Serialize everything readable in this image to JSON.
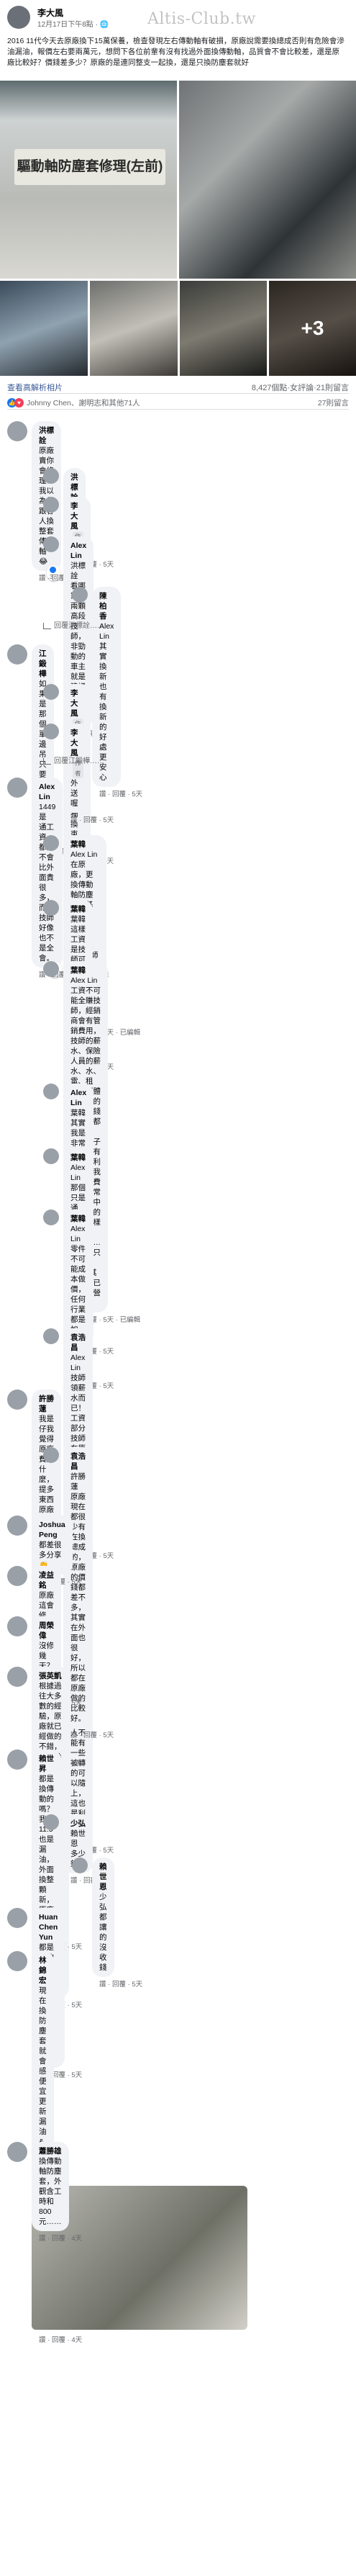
{
  "watermark": "Altis-Club.tw",
  "post": {
    "author": "李大風",
    "time": "12月17日下午8點 · ",
    "text": "2016 11代今天去原廠換下15萬保養，檢查發現左右傳動軸有破損，原廠說需要換總成否則有危險會滲油漏油，報價左右要兩萬元，想問下各位前輩有沒有找過外面換傳動軸，品質會不會比較差，還是原廠比較好？價錢差多少？原廠的是連同整支一起換，還是只換防塵套就好",
    "sign_text": "驅動軸防塵套修理(左前)",
    "more_photos": "+3"
  },
  "bar1": {
    "left": "查看高解析相片",
    "right": "8,427個點·女評論·21則留言"
  },
  "bar2": {
    "reactions": "Johnny Chen、謝明志和其他71人",
    "comments": "27則留言"
  },
  "comments": [
    {
      "name": "洪標詮",
      "text": "原廠賣你會修理？我以為都跟客人換整套傳動軸😂",
      "acts": "讚 · 回覆 · 5天",
      "reacts": "3"
    },
    {
      "name": "洪標詮",
      "text": "修理也價格",
      "acts": "讚 · 回覆 · 5天"
    },
    {
      "name": "李大風",
      "author": "作者",
      "text": "洪標詮 修理後的價格",
      "tag": "洪標詮",
      "acts": "讚 · 回覆 · 5天"
    },
    {
      "name": "Alex Lin",
      "text": "洪標詮 看哪家的兩顆高段技師，非勁動的車主就是建議換新續送。",
      "tag": "洪標詮",
      "acts": "讚 · 回覆 · 5天"
    },
    {
      "name": "陳柏香",
      "text": "Alex Lin 其實換新也有換新的好處 更安心",
      "tag": "Alex Lin",
      "acts": "讚 · 回覆 · 5天"
    },
    {
      "reply_to": "回覆洪標詮……"
    },
    {
      "name": "江鍛樺",
      "text": "如果是那個單邊吊只要要換束環就好",
      "acts": "讚 · 回覆 · 5天"
    },
    {
      "name": "李大風",
      "author": "作者",
      "text": "江明樺 原廠沒單獨換束環",
      "tag": "江明樺",
      "acts": "讚 · 回覆 · 5天"
    },
    {
      "name": "李大風",
      "author": "作者",
      "text": "外送喔",
      "acts": "讚 · 回覆 · 5天"
    },
    {
      "reply_to": "回覆江鍛樺……"
    },
    {
      "name": "Alex Lin",
      "text": "1449是 通工資，都是不會比外面貴很多，而且技師好像也不是全會。",
      "acts": "讚 · 回覆 · 5天 · 已編輯",
      "reacts": "4"
    },
    {
      "name": "葉韓",
      "author": "",
      "text": "Alex Lin 在原廠，更換傳動軸防塵套是基本功，我當年都是在彰化乾(美援)師傅換一個套子$1000，按道理子是真的不貴",
      "tag": "Alex Lin",
      "acts": "讚 · 回覆 · 5天 · 已編輯"
    },
    {
      "name": "葉韓",
      "text": "葉韓 這樣工資是技師可以全拿嗎？還是也要被經銷公司抽成？",
      "tag": "葉韓",
      "acts": "讚 · 回覆 · 5天"
    },
    {
      "name": "葉韓",
      "text": "Alex Lin 工資不可能全賺技師，經銷商會有管銷費用，技師的薪水、保險人員的薪水、水、電、租金、硬體等費用的一切水錢都們，都要花錢買，環子還要卻有上些的利潤。但我一樣收費做是非常的就是中等，你的就與一樣「常觀的。……所以你只「要算」，其實是早已算有運營的表。",
      "tag": "Alex Lin",
      "acts": "讚 · 回覆 · 5天 · 已編輯"
    },
    {
      "name": "Alex Lin",
      "text": "葉韓 其實我是非常贊成不要換的，我也會些做 有什麼。 就和工資他或然比較便宜，就是技術費囉。",
      "tag": "葉韓",
      "acts": "讚 · 回覆 · 5天"
    },
    {
      "name": "葉韓",
      "text": "Alex Lin 那個只是通理，現在要 跟換人收多少，就所以多少利潤，在我這裡是我決定的。",
      "tag": "Alex Lin",
      "acts": "讚 · 回覆 · 5天"
    },
    {
      "name": "葉韓",
      "text": "Alex Lin 零件不可能成本做價，任何行業都是如此，沒利潤誰不才很困擾什麼一樣東西事，工資更不可能全體技師，老闆提供場地、工具設備，這些都是讓維修人員成本的，這些成本要同時將這成本上應計入，有的人不能有一些被轉的可以隨上，這也是利潤的。",
      "tag": "Alex Lin",
      "acts": "讚 · 回覆 · 5天"
    },
    {
      "name": "袁浩昌",
      "text": "Alex Lin 技師領薪水而已！工資部分技師在原廠都是領月薪，被扣工資，一直砍！",
      "tag": "Alex Lin",
      "acts": "讚 · 回覆 · 5天",
      "reacts": "1"
    },
    {
      "name": "許勝蓮",
      "text": "我是仔我覺得原廠費是什麼，提多東西原廠也不會比較貴，都不能完成的話，非常便宜就會換套防塵就好，外面真的比較便宜，你價值比我是換原廠原廠都是換總成。",
      "acts": "讚 · 回覆 · 5天"
    },
    {
      "name": "袁浩昌",
      "text": "許勝蓮 原廠現在都很少有在換總成的，原廠的價錢都差不多，其實在外面也很好，所以都在原廠做的比較好。",
      "tag": "許勝蓮",
      "acts": "讚 · 回覆 · 5天"
    },
    {
      "name": "Joshua Peng",
      "text": "都差很多分享👏",
      "acts": "讚 · 回覆 · 5天"
    },
    {
      "name": "凌益銘",
      "text": "原廠這會修理？原廠都叫人換整支新的！",
      "acts": "讚 · 回覆 · 5天"
    },
    {
      "name": "周榮偉",
      "text": "沒修幾天？這原廠沒做到不行，不會給修？",
      "acts": "讚 · 回覆 · 5天"
    },
    {
      "name": "張英凱",
      "text": "根據過往大多數的經驗，原廠就已經做的不錯，要更換或修理的話，像是在一般外面，做過修理的話還是有原廠的那也不錯，而如果會發生在可能，外面的原廠到國產，外面的，都才比外面是有大數量的……",
      "acts": "讚 · 回覆 · 5天"
    },
    {
      "name": "賴世昇",
      "text": "都是換傳動的嗎？我11.5也是漏油，外面換整顆新，原廠換總成。",
      "acts": "讚 · 回覆 · 5天"
    },
    {
      "name": "少弘",
      "text": "賴世恩 多少錢？",
      "tag": "賴世恩",
      "acts": "讚 · 回覆 · 5天"
    },
    {
      "name": "賴世恩",
      "text": "少弘 都讓的沒收錢",
      "tag": "少弘",
      "acts": "讚 · 回覆 · 5天"
    },
    {
      "name": "Huan Chen Yun",
      "text": "都是錢的問題。不用錢都換你好好我可以等一等死",
      "acts": "讚 · 回覆 · 5天"
    },
    {
      "name": "林錦宏",
      "text": "現在換防塵套就會感便宜更新漏油&新束環",
      "acts": "讚 · 回覆 · 4天"
    },
    {
      "name": "蕭勝雄",
      "text": "換傳動軸防塵套，外觀含工時和800元……",
      "acts": "讚 · 回覆 · 4天"
    }
  ]
}
